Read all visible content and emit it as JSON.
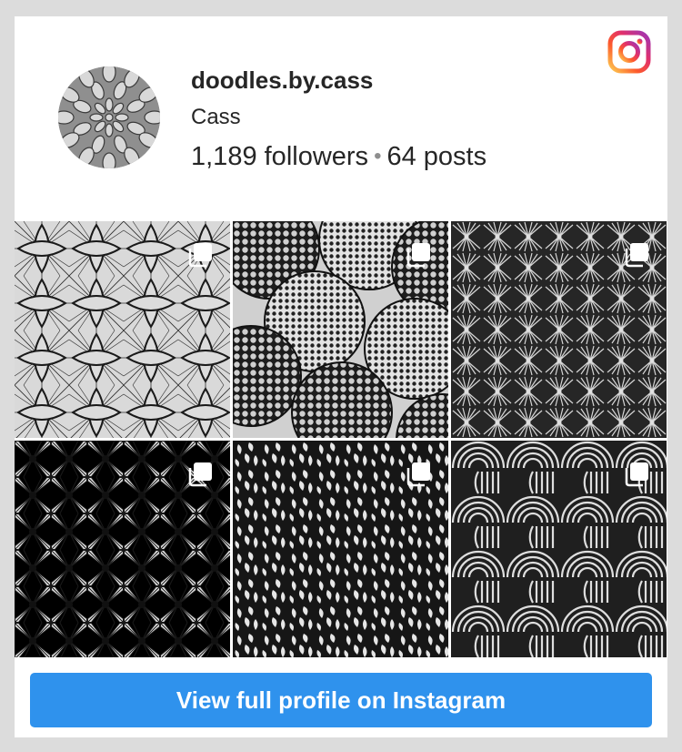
{
  "profile": {
    "username": "doodles.by.cass",
    "full_name": "Cass",
    "followers": "1,189 followers",
    "separator": "•",
    "posts": "64 posts"
  },
  "icons": {
    "platform_logo": "instagram-icon",
    "post_badge": "multiple-images-icon"
  },
  "posts": [
    {
      "pattern": "curved lattice with petal shapes",
      "multiple": true
    },
    {
      "pattern": "overlapping circles filled with dots",
      "multiple": true
    },
    {
      "pattern": "repeating fan rays",
      "multiple": true
    },
    {
      "pattern": "grid of starbursts",
      "multiple": true
    },
    {
      "pattern": "scattered teardrop petals",
      "multiple": true
    },
    {
      "pattern": "concentric half circles",
      "multiple": true
    }
  ],
  "cta": {
    "label": "View full profile on Instagram"
  },
  "colors": {
    "background": "#dcdcdc",
    "card": "#ffffff",
    "button": "#2f92ed",
    "text": "#262626",
    "muted": "#8e8e8e"
  }
}
